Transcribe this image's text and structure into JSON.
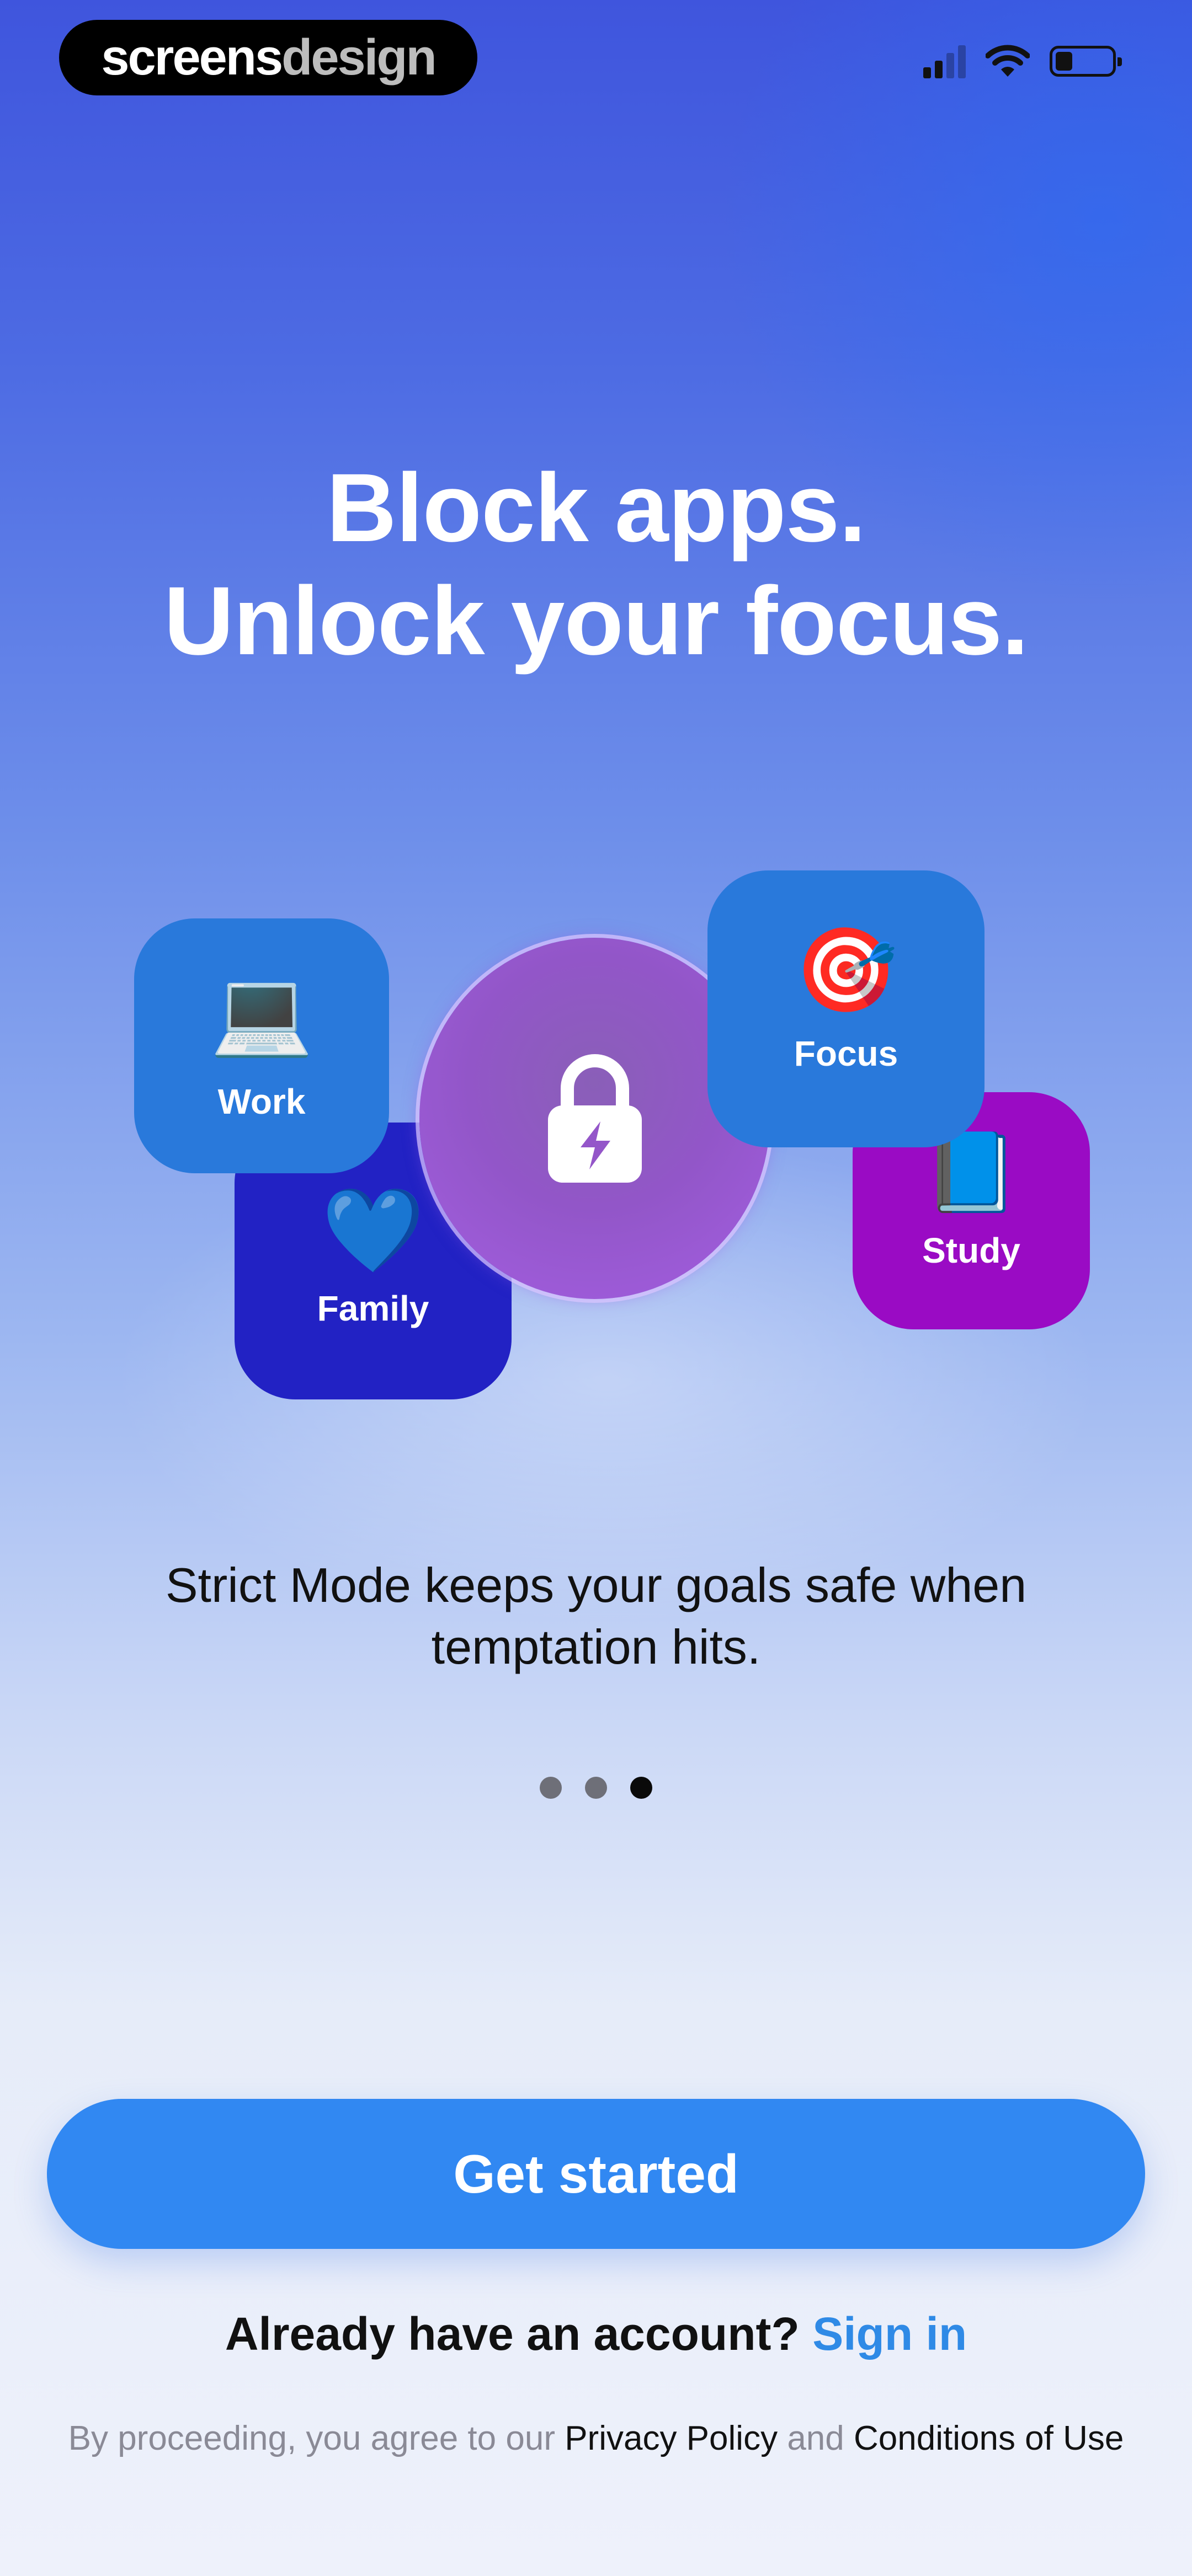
{
  "brand": {
    "part1": "screens",
    "part2": "design"
  },
  "headline": {
    "line1": "Block apps.",
    "line2": "Unlock your focus."
  },
  "tiles": {
    "work": {
      "label": "Work",
      "emoji": "💻"
    },
    "family": {
      "label": "Family",
      "emoji": "💙"
    },
    "focus": {
      "label": "Focus",
      "emoji": "🎯"
    },
    "study": {
      "label": "Study",
      "emoji": "📘"
    }
  },
  "caption": {
    "line1": "Strict Mode keeps your goals safe when",
    "line2": "temptation hits."
  },
  "pager": {
    "count": 3,
    "active_index": 2
  },
  "cta": {
    "label": "Get started"
  },
  "signin": {
    "prompt": "Already have an account?",
    "link": "Sign in"
  },
  "legal": {
    "prefix": "By proceeding, you agree to our",
    "privacy": "Privacy Policy",
    "and": "and",
    "terms": "Conditions of Use"
  },
  "colors": {
    "accent": "#3188f2",
    "link": "#2f8ae6"
  },
  "icons": [
    "cellular-signal-icon",
    "wifi-icon",
    "battery-icon",
    "lock-bolt-icon"
  ]
}
